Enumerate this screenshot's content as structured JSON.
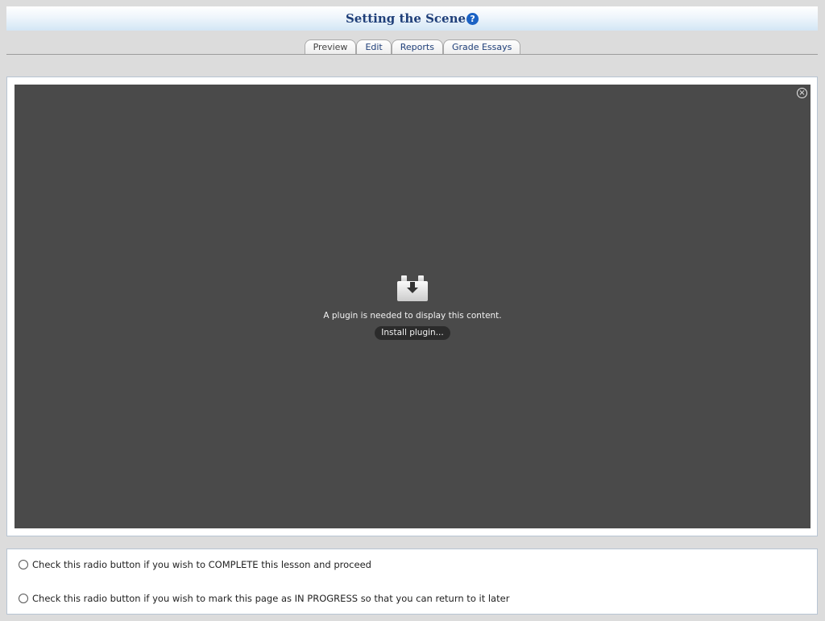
{
  "header": {
    "title": "Setting the Scene",
    "help_icon": "?"
  },
  "tabs": [
    {
      "label": "Preview",
      "active": true
    },
    {
      "label": "Edit",
      "active": false
    },
    {
      "label": "Reports",
      "active": false
    },
    {
      "label": "Grade Essays",
      "active": false
    }
  ],
  "plugin": {
    "close_icon": "×",
    "message": "A plugin is needed to display this content.",
    "install_label": "Install plugin..."
  },
  "options": {
    "complete_label": "Check this radio button if you wish to COMPLETE this lesson and proceed",
    "in_progress_label": "Check this radio button if you wish to mark this page as IN PROGRESS so that you can return to it later"
  },
  "colors": {
    "title": "#1f3f79",
    "plugin_background": "#4a4a4a",
    "help_icon": "#1b62c4"
  }
}
